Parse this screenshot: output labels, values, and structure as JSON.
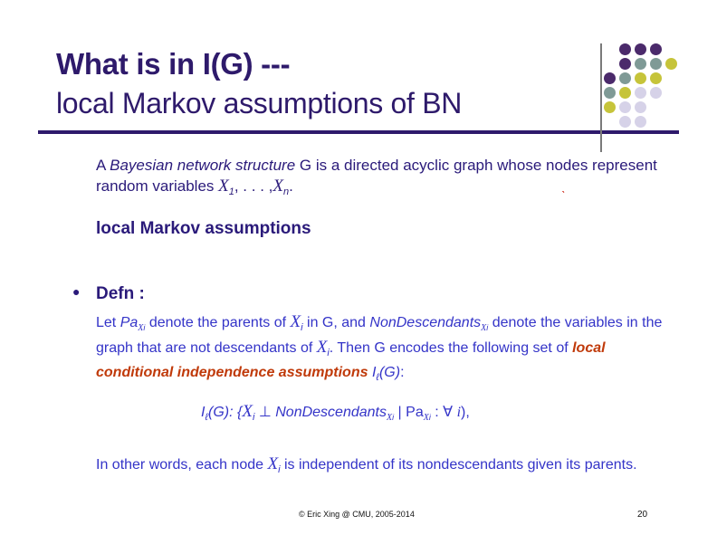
{
  "title": {
    "line1": "What is in I(G) ---",
    "line2": "local Markov assumptions of BN"
  },
  "colors": {
    "title": "#2e1a6b",
    "body": "#3434c8",
    "emphasis": "#c03a0a",
    "dot_purple": "#4b2a6b",
    "dot_gray": "#7f9a96",
    "dot_olive": "#c6c43a",
    "dot_lavender": "#d6d2e8"
  },
  "intro": {
    "p1": "A ",
    "p2_italic": "Bayesian network structure",
    "p3": " G is a directed acyclic graph whose nodes represent random variables ",
    "x": "X",
    "sub1": "1",
    "dots": ", . . . ,",
    "subn": "n",
    "period": "."
  },
  "stray_mark": "ˋ",
  "section_heading": "local Markov assumptions",
  "bullet_glyph": "●",
  "defn_label": "Defn :",
  "definition": {
    "t1": "Let ",
    "pa": "Pa",
    "t2": " denote the parents of ",
    "t3": " in G, and ",
    "nondesc": "NonDescendants",
    "t4": " denote the variables in the graph that are not descendants of ",
    "t5": ". Then G encodes the following set of ",
    "emph": "local conditional independence assumptions",
    "t6": " ",
    "il": "I",
    "l": "ℓ",
    "g": "(G)",
    "t7": ":"
  },
  "formula": {
    "il": "I",
    "l": "ℓ",
    "g": "(G): {",
    "x": "X",
    "i": "i",
    "perp": " ⊥ ",
    "nondesc": "NonDescendants",
    "bar": " | Pa",
    "colon": " : ∀ ",
    "end": "),"
  },
  "conclusion": {
    "t1": "In other words, each node ",
    "x": "X",
    "i": "i",
    "t2": " is independent of its nondescendants given its parents."
  },
  "footer": "© Eric Xing @ CMU, 2005-2014",
  "page_number": "20"
}
